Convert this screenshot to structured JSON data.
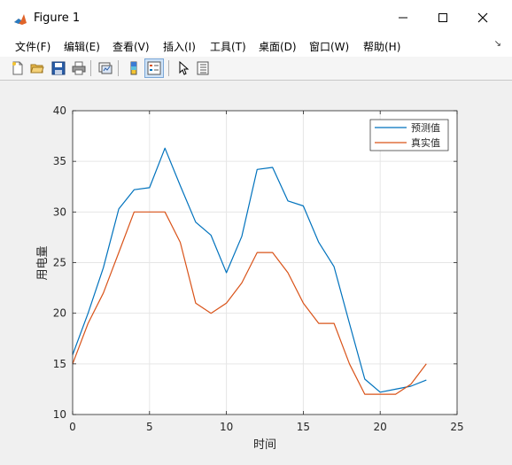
{
  "window": {
    "title": "Figure 1"
  },
  "menu": [
    "文件(F)",
    "编辑(E)",
    "查看(V)",
    "插入(I)",
    "工具(T)",
    "桌面(D)",
    "窗口(W)",
    "帮助(H)"
  ],
  "toolbar_icons": [
    "new-figure-icon",
    "open-file-icon",
    "save-icon",
    "print-icon",
    "link-plot-icon",
    "colorbar-icon",
    "legend-icon",
    "edit-plot-arrow-icon",
    "property-inspector-icon"
  ],
  "colors": {
    "series1": "#0072BD",
    "series2": "#D95319",
    "grid": "#e6e6e6"
  },
  "chart_data": {
    "type": "line",
    "xlabel": "时间",
    "ylabel": "用电量",
    "xlim": [
      0,
      25
    ],
    "ylim": [
      10,
      40
    ],
    "xticks": [
      0,
      5,
      10,
      15,
      20,
      25
    ],
    "yticks": [
      10,
      15,
      20,
      25,
      30,
      35,
      40
    ],
    "grid": true,
    "legend_position": "top-right",
    "x": [
      0,
      1,
      2,
      3,
      4,
      5,
      6,
      7,
      8,
      9,
      10,
      11,
      12,
      13,
      14,
      15,
      16,
      17,
      18,
      19,
      20,
      21,
      22,
      23
    ],
    "series": [
      {
        "name": "预测值",
        "color": "#0072BD",
        "values": [
          15.9,
          20.0,
          24.5,
          30.3,
          32.2,
          32.4,
          36.3,
          32.6,
          29.0,
          27.7,
          24.0,
          27.6,
          34.2,
          34.4,
          31.1,
          30.6,
          27.0,
          24.6,
          19.0,
          13.5,
          12.2,
          12.5,
          12.8,
          13.4
        ]
      },
      {
        "name": "真实值",
        "color": "#D95319",
        "values": [
          15,
          19,
          22,
          26,
          30,
          30,
          30,
          27,
          21,
          20,
          21,
          23,
          26,
          26,
          24,
          21,
          19,
          19,
          15,
          12,
          12,
          12,
          13,
          15
        ]
      }
    ]
  }
}
